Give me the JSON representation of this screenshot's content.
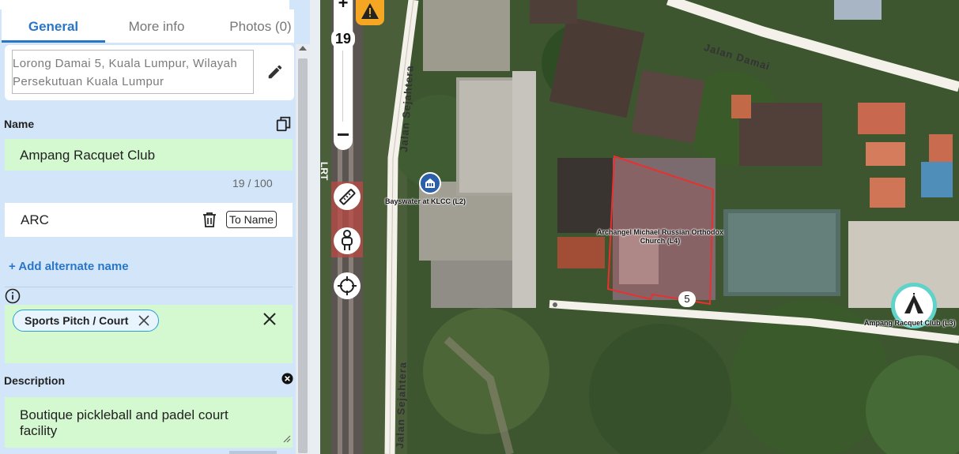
{
  "tabs": [
    {
      "label": "General",
      "active": true
    },
    {
      "label": "More info",
      "active": false
    },
    {
      "label": "Photos (0)",
      "active": false
    }
  ],
  "address": {
    "line1": "Lorong Damai 5, Kuala Lumpur, Wilayah",
    "line2": "Persekutuan Kuala Lumpur"
  },
  "name_section": {
    "label": "Name",
    "value": "Ampang Racquet Club",
    "counter": "19 / 100"
  },
  "alternate_name": {
    "value": "ARC",
    "to_name_label": "To Name"
  },
  "add_alternate_label": "+ Add alternate name",
  "category": {
    "tag_label": "Sports Pitch / Court"
  },
  "description": {
    "label": "Description",
    "value_line1": "Boutique pickleball and padel court",
    "value_line2": "facility"
  },
  "map": {
    "zoom_level": "19",
    "roads": {
      "jalan_damai": "Jalan Damai",
      "jalan_sejahtera_top": "Jalan Sejahtera",
      "jalan_sejahtera_bottom": "Jalan Sejahtera"
    },
    "poi_labels": {
      "bayswater": "Bayswater at KLCC (L2)",
      "church_line1": "Archangel Michael Russian Orthodox",
      "church_line2": "Church (L4)",
      "racquet_club": "Ampang Racquet Club (L3)"
    },
    "badge_number": "5",
    "rail_label": "LRT"
  },
  "colors": {
    "accent": "#2a76c6",
    "panel_bg": "#d3e6f9",
    "field_green": "#d4f8cf",
    "selection_red": "#e8312f",
    "warning_orange": "#f5a623",
    "venue_teal": "#5fd3c9"
  }
}
